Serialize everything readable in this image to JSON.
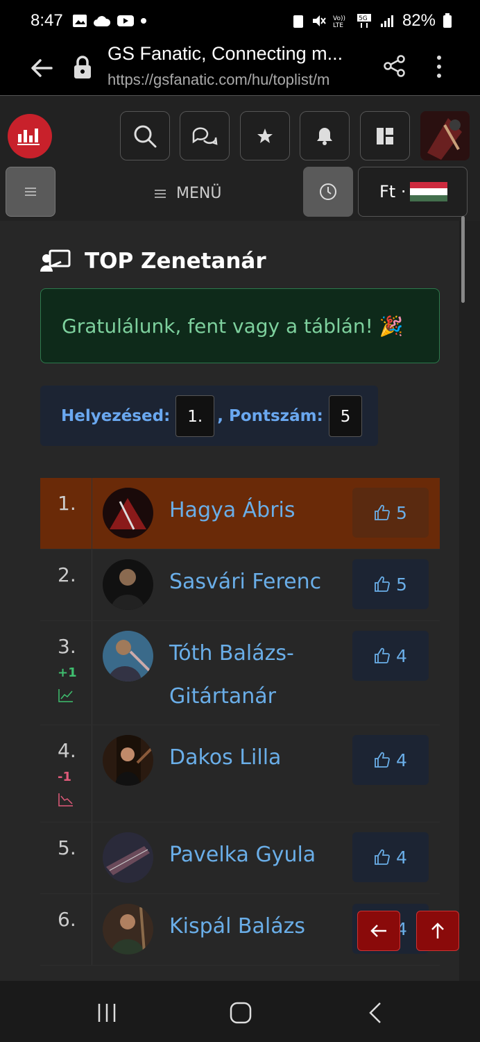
{
  "status": {
    "time": "8:47",
    "battery": "82%"
  },
  "browser": {
    "title": "GS Fanatic, Connecting m...",
    "url": "https://gsfanatic.com/hu/toplist/m"
  },
  "header": {
    "menu_label": "MENÜ",
    "currency": "Ft ·"
  },
  "page": {
    "title": "TOP Zenetanár",
    "alert": "Gratulálunk, fent vagy a táblán! 🎉",
    "rank_label": "Helyezésed",
    "rank_value": "1.",
    "score_label": "Pontszám",
    "score_value": "5"
  },
  "toplist": [
    {
      "rank": "1.",
      "name": "Hagya Ábris",
      "likes": "5",
      "delta": ""
    },
    {
      "rank": "2.",
      "name": "Sasvári Ferenc",
      "likes": "5",
      "delta": ""
    },
    {
      "rank": "3.",
      "name": "Tóth Balázs-Gitártanár",
      "likes": "4",
      "delta": "+1"
    },
    {
      "rank": "4.",
      "name": "Dakos Lilla",
      "likes": "4",
      "delta": "-1"
    },
    {
      "rank": "5.",
      "name": "Pavelka Gyula",
      "likes": "4",
      "delta": ""
    },
    {
      "rank": "6.",
      "name": "Kispál Balázs",
      "likes": "4",
      "delta": ""
    }
  ],
  "colors": {
    "accent_red": "#c8212b",
    "link_blue": "#6aaee8",
    "highlight_row": "#6a2a08",
    "up": "#3fbf6f",
    "down": "#e05a7a"
  }
}
